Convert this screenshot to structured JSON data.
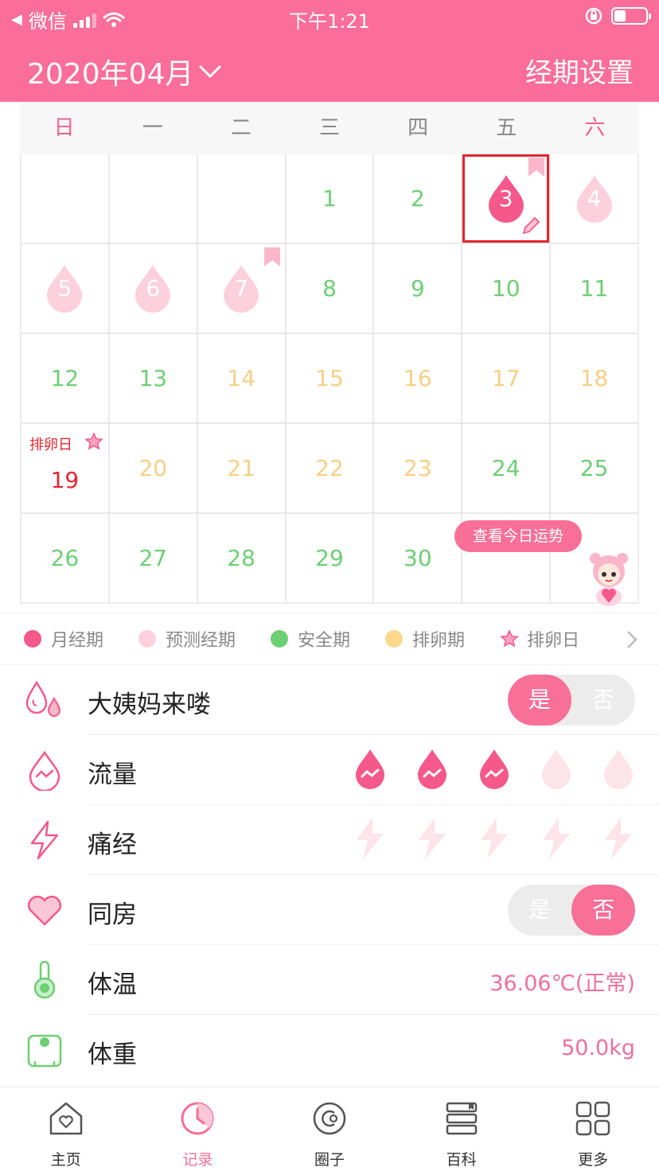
{
  "status_bar": {
    "back_app": "微信",
    "time": "下午1:21"
  },
  "header": {
    "month": "2020年04月",
    "settings": "经期设置"
  },
  "calendar": {
    "weekdays": [
      "日",
      "一",
      "二",
      "三",
      "四",
      "五",
      "六"
    ],
    "cells": [
      {
        "d": ""
      },
      {
        "d": ""
      },
      {
        "d": ""
      },
      {
        "d": "1",
        "t": "safe"
      },
      {
        "d": "2",
        "t": "safe"
      },
      {
        "d": "3",
        "t": "period",
        "flag": true,
        "selected": true
      },
      {
        "d": "4",
        "t": "predicted"
      },
      {
        "d": "5",
        "t": "predicted"
      },
      {
        "d": "6",
        "t": "predicted"
      },
      {
        "d": "7",
        "t": "predicted",
        "flag": true
      },
      {
        "d": "8",
        "t": "safe"
      },
      {
        "d": "9",
        "t": "safe"
      },
      {
        "d": "10",
        "t": "safe"
      },
      {
        "d": "11",
        "t": "safe"
      },
      {
        "d": "12",
        "t": "safe"
      },
      {
        "d": "13",
        "t": "safe"
      },
      {
        "d": "14",
        "t": "ovulation-period"
      },
      {
        "d": "15",
        "t": "ovulation-period"
      },
      {
        "d": "16",
        "t": "ovulation-period"
      },
      {
        "d": "17",
        "t": "ovulation-period"
      },
      {
        "d": "18",
        "t": "ovulation-period"
      },
      {
        "d": "19",
        "t": "ovulation-day",
        "label": "排卵日"
      },
      {
        "d": "20",
        "t": "ovulation-period"
      },
      {
        "d": "21",
        "t": "ovulation-period"
      },
      {
        "d": "22",
        "t": "ovulation-period"
      },
      {
        "d": "23",
        "t": "ovulation-period"
      },
      {
        "d": "24",
        "t": "safe"
      },
      {
        "d": "25",
        "t": "safe"
      },
      {
        "d": "26",
        "t": "safe"
      },
      {
        "d": "27",
        "t": "safe"
      },
      {
        "d": "28",
        "t": "safe"
      },
      {
        "d": "29",
        "t": "safe"
      },
      {
        "d": "30",
        "t": "safe"
      },
      {
        "d": ""
      },
      {
        "d": ""
      }
    ],
    "fortune_button": "查看今日运势"
  },
  "legend": [
    {
      "label": "月经期",
      "color": "#f5588a"
    },
    {
      "label": "预测经期",
      "color": "#ffd0dd"
    },
    {
      "label": "安全期",
      "color": "#6dcf73"
    },
    {
      "label": "排卵期",
      "color": "#fbd98d"
    },
    {
      "label": "排卵日",
      "color": "#f5588a"
    }
  ],
  "records": {
    "period_came": {
      "label": "大姨妈来喽",
      "yes": "是",
      "no": "否",
      "value": "是"
    },
    "flow": {
      "label": "流量",
      "level": 3,
      "max": 5
    },
    "cramps": {
      "label": "痛经",
      "level": 0,
      "max": 5
    },
    "intimacy": {
      "label": "同房",
      "yes": "是",
      "no": "否",
      "value": "否"
    },
    "temperature": {
      "label": "体温",
      "value": "36.06℃(正常)"
    },
    "weight": {
      "label": "体重",
      "value": "50.0kg"
    }
  },
  "tabs": [
    {
      "label": "主页",
      "icon": "home-icon"
    },
    {
      "label": "记录",
      "icon": "record-clock-icon",
      "active": true
    },
    {
      "label": "圈子",
      "icon": "circle-icon"
    },
    {
      "label": "百科",
      "icon": "books-icon"
    },
    {
      "label": "更多",
      "icon": "grid-icon"
    }
  ],
  "colors": {
    "brand": "#fb6d9a",
    "safe": "#6dcf73",
    "ovulation": "#f7cf85",
    "ovulation_day": "#e5272f"
  }
}
